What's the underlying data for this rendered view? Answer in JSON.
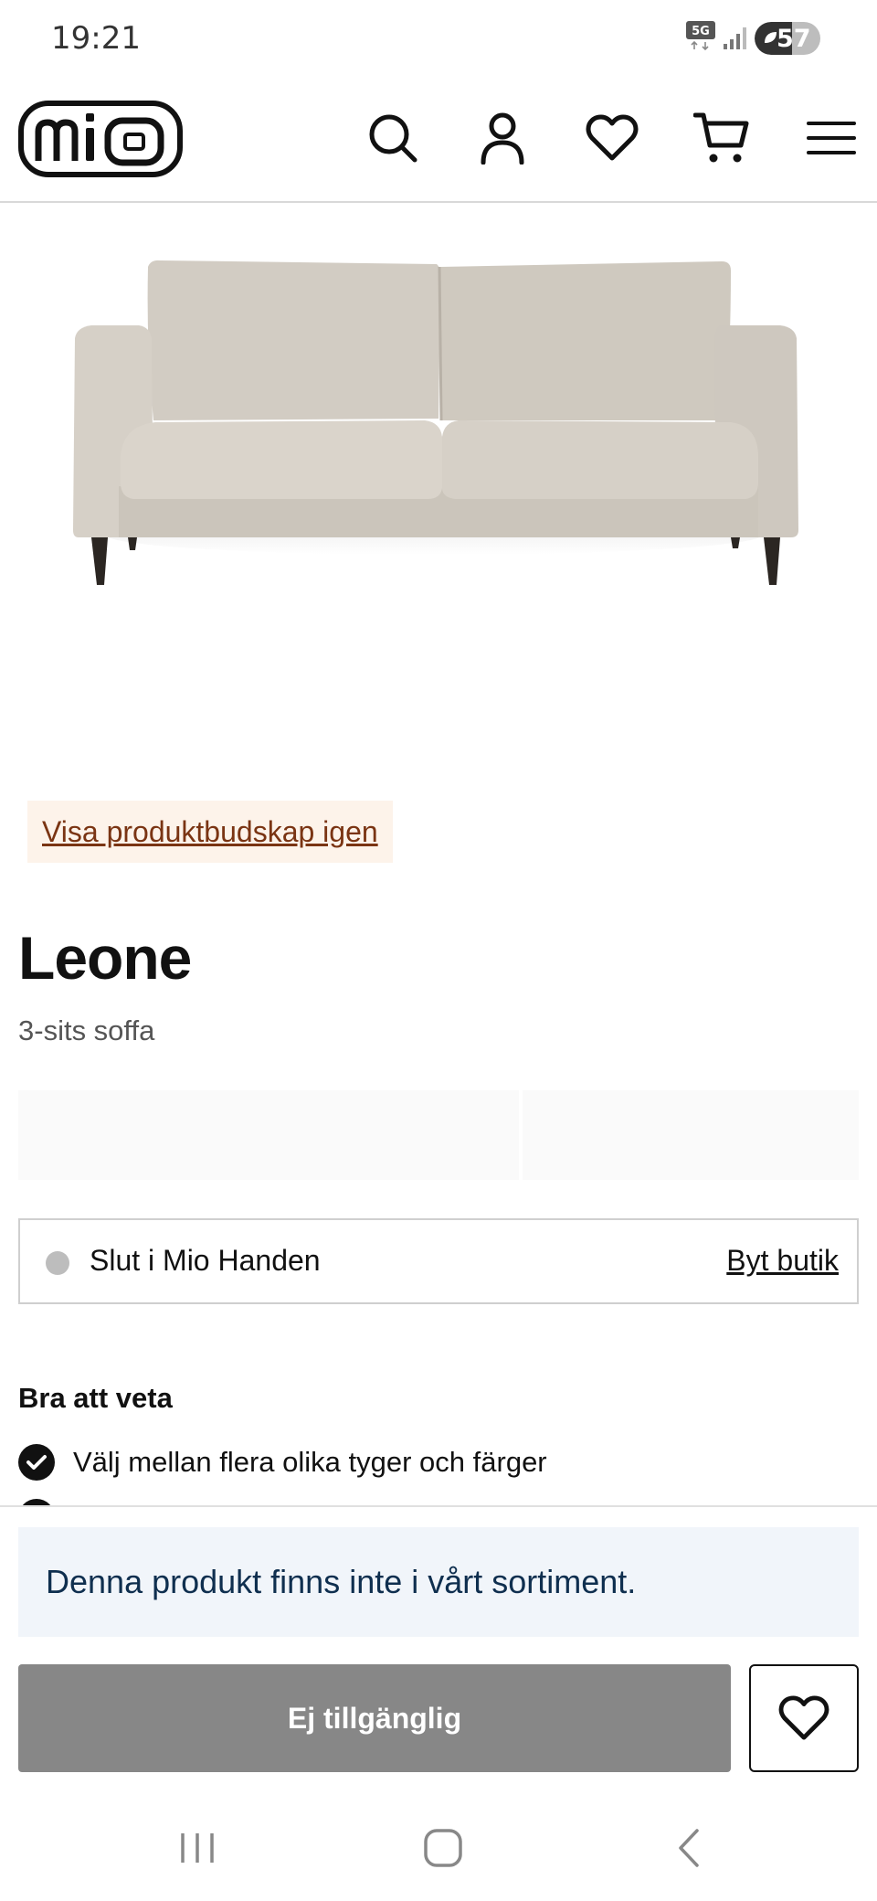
{
  "status_bar": {
    "time": "19:21",
    "network": "5G",
    "battery_level": 57,
    "battery_text": "57"
  },
  "header": {
    "logo_text": "mio",
    "icons": [
      "search-icon",
      "account-icon",
      "heart-icon",
      "cart-icon",
      "menu-icon"
    ]
  },
  "product": {
    "image_icon": "sofa-image",
    "show_message_link": "Visa produktbudskap igen",
    "title": "Leone",
    "subtitle": "3-sits soffa"
  },
  "store": {
    "stock_status": "Slut i Mio Handen",
    "change_store_link": "Byt butik"
  },
  "good_to_know": {
    "heading": "Bra att veta",
    "items": [
      "Välj mellan flera olika tyger och färger"
    ]
  },
  "sticky_panel": {
    "notice": "Denna produkt finns inte i vårt sortiment.",
    "unavailable_button": "Ej tillgänglig"
  },
  "colors": {
    "link_brown": "#7a3413",
    "link_bg": "#fdf3ea",
    "notice_bg": "#f1f5fa",
    "disabled_button": "#878787"
  }
}
